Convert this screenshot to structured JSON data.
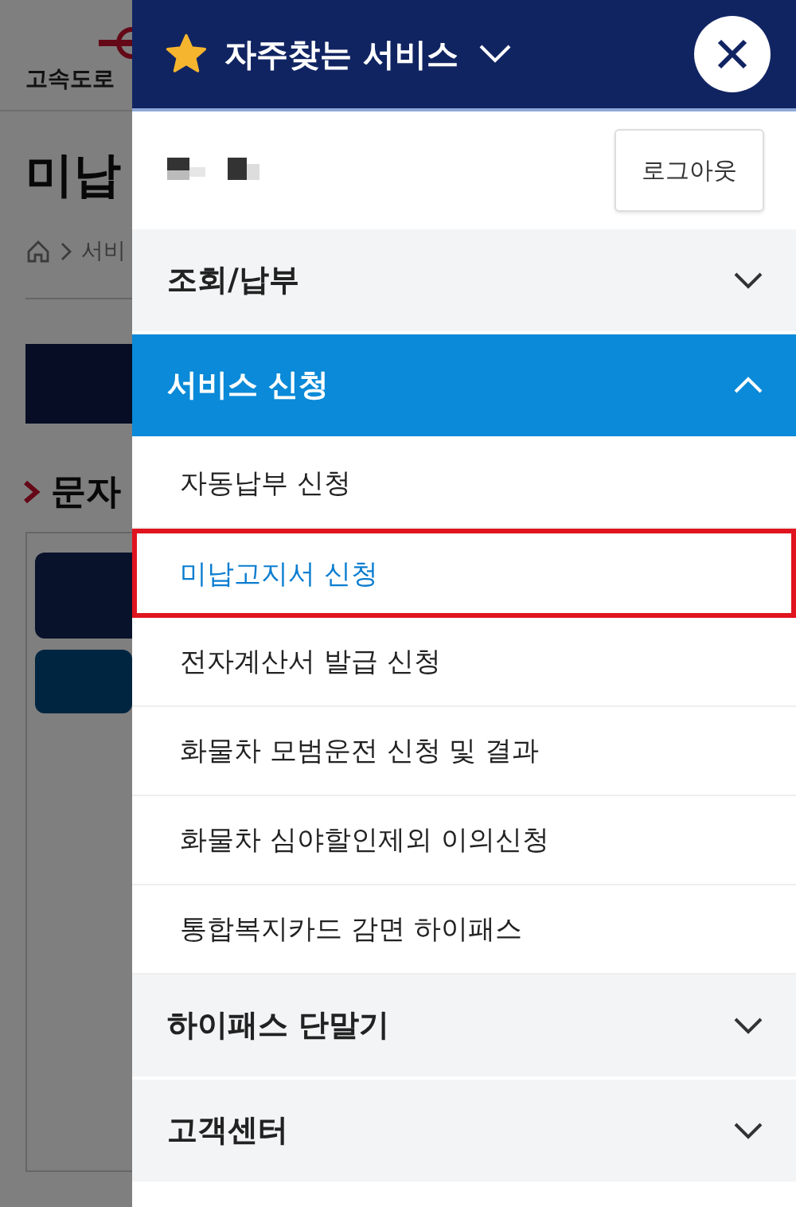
{
  "background_page": {
    "logo_text": "고속도로",
    "title": "미납",
    "breadcrumb": "서비",
    "section_heading": "문자"
  },
  "drawer": {
    "title": "자주찾는 서비스",
    "logout": "로그아웃",
    "menu": [
      {
        "label": "조회/납부",
        "expanded": false
      },
      {
        "label": "서비스 신청",
        "expanded": true,
        "children": [
          {
            "label": "자동납부 신청",
            "selected": false
          },
          {
            "label": "미납고지서 신청",
            "selected": true
          },
          {
            "label": "전자계산서 발급 신청",
            "selected": false
          },
          {
            "label": "화물차 모범운전 신청 및 결과",
            "selected": false
          },
          {
            "label": "화물차 심야할인제외 이의신청",
            "selected": false
          },
          {
            "label": "통합복지카드 감면 하이패스",
            "selected": false
          }
        ]
      },
      {
        "label": "하이패스 단말기",
        "expanded": false
      },
      {
        "label": "고객센터",
        "expanded": false
      }
    ]
  }
}
